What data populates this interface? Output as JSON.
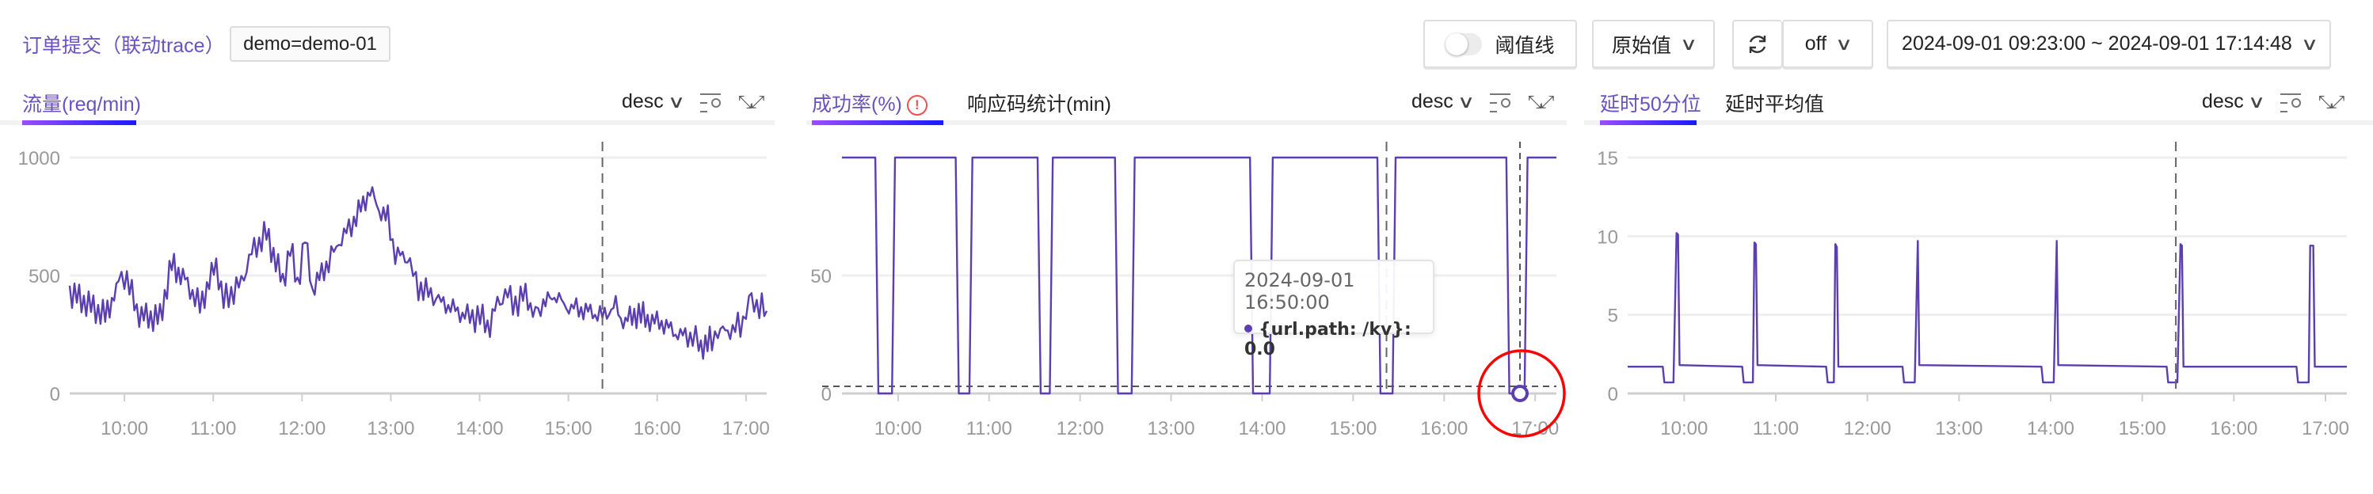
{
  "header": {
    "title": "订单提交（联动trace）",
    "tag": "demo=demo-01",
    "threshold_toggle": {
      "label": "阈值线",
      "on": false
    },
    "value_mode": {
      "label": "原始值",
      "icon": "chevron-down-icon"
    },
    "refresh": {
      "icon": "refresh-icon",
      "interval": "off"
    },
    "time_range": "2024-09-01 09:23:00 ~ 2024-09-01 17:14:48"
  },
  "colors": {
    "accent": "#6a52c0",
    "series": "#5b3fb0",
    "highlight": "#ff0000",
    "warn": "#f05050"
  },
  "panels": [
    {
      "tabs": [
        {
          "label": "流量(req/min)",
          "active": true
        }
      ],
      "sort": "desc",
      "warn_icon": false
    },
    {
      "tabs": [
        {
          "label": "成功率(%)",
          "active": true
        },
        {
          "label": "响应码统计(min)",
          "active": false
        }
      ],
      "sort": "desc",
      "warn_icon": "!"
    },
    {
      "tabs": [
        {
          "label": "延时50分位",
          "active": true
        },
        {
          "label": "延时平均值",
          "active": false
        }
      ],
      "sort": "desc",
      "warn_icon": false
    }
  ],
  "tooltip": {
    "time": "2024-09-01 16:50:00",
    "series": "{url.path: /kv}",
    "value": "0.0"
  },
  "chart_data": [
    {
      "type": "line",
      "xlim": [
        "09:23",
        "17:14"
      ],
      "xticks": [
        "10:00",
        "11:00",
        "12:00",
        "13:00",
        "14:00",
        "15:00",
        "16:00",
        "17:00"
      ],
      "ylim": [
        0,
        1000
      ],
      "yticks": [
        0,
        500,
        1000
      ],
      "grid": true,
      "marker_line": "15:23",
      "points": [
        [
          "09:23",
          430
        ],
        [
          "09:47",
          330
        ],
        [
          "09:56",
          460
        ],
        [
          "10:00",
          510
        ],
        [
          "10:10",
          330
        ],
        [
          "10:24",
          320
        ],
        [
          "10:32",
          550
        ],
        [
          "10:41",
          480
        ],
        [
          "10:51",
          370
        ],
        [
          "11:02",
          550
        ],
        [
          "11:07",
          390
        ],
        [
          "11:19",
          470
        ],
        [
          "11:26",
          600
        ],
        [
          "11:36",
          680
        ],
        [
          "11:47",
          470
        ],
        [
          "11:52",
          620
        ],
        [
          "11:57",
          460
        ],
        [
          "12:02",
          660
        ],
        [
          "12:07",
          440
        ],
        [
          "12:18",
          560
        ],
        [
          "12:25",
          640
        ],
        [
          "12:35",
          730
        ],
        [
          "12:46",
          860
        ],
        [
          "12:52",
          780
        ],
        [
          "12:58",
          740
        ],
        [
          "13:03",
          590
        ],
        [
          "13:13",
          570
        ],
        [
          "13:17",
          460
        ],
        [
          "13:27",
          420
        ],
        [
          "13:34",
          390
        ],
        [
          "13:50",
          330
        ],
        [
          "14:02",
          320
        ],
        [
          "14:07",
          280
        ],
        [
          "14:12",
          390
        ],
        [
          "14:19",
          420
        ],
        [
          "14:26",
          370
        ],
        [
          "14:31",
          440
        ],
        [
          "14:36",
          330
        ],
        [
          "14:43",
          380
        ],
        [
          "14:52",
          420
        ],
        [
          "14:57",
          370
        ],
        [
          "15:07",
          360
        ],
        [
          "15:18",
          340
        ],
        [
          "15:23",
          330
        ],
        [
          "15:32",
          370
        ],
        [
          "15:37",
          300
        ],
        [
          "15:46",
          340
        ],
        [
          "15:55",
          310
        ],
        [
          "16:03",
          300
        ],
        [
          "16:14",
          250
        ],
        [
          "16:24",
          240
        ],
        [
          "16:28",
          200
        ],
        [
          "16:37",
          220
        ],
        [
          "16:41",
          260
        ],
        [
          "16:51",
          270
        ],
        [
          "16:58",
          300
        ],
        [
          "17:02",
          400
        ],
        [
          "17:09",
          370
        ],
        [
          "17:14",
          350
        ]
      ]
    },
    {
      "type": "line",
      "xlim": [
        "09:23",
        "17:14"
      ],
      "xticks": [
        "10:00",
        "11:00",
        "12:00",
        "13:00",
        "14:00",
        "15:00",
        "16:00",
        "17:00"
      ],
      "ylim": [
        0,
        100
      ],
      "yticks": [
        0,
        50
      ],
      "grid": true,
      "marker_line": "15:22",
      "hover_line": "16:50",
      "threshold": 3,
      "highlight_point": [
        "16:50",
        0
      ],
      "points": [
        [
          "09:23",
          100
        ],
        [
          "09:45",
          100
        ],
        [
          "09:47",
          0
        ],
        [
          "09:56",
          0
        ],
        [
          "09:58",
          100
        ],
        [
          "10:38",
          100
        ],
        [
          "10:40",
          0
        ],
        [
          "10:47",
          0
        ],
        [
          "10:49",
          100
        ],
        [
          "11:32",
          100
        ],
        [
          "11:34",
          0
        ],
        [
          "11:40",
          0
        ],
        [
          "11:42",
          100
        ],
        [
          "12:23",
          100
        ],
        [
          "12:25",
          0
        ],
        [
          "12:34",
          0
        ],
        [
          "12:36",
          100
        ],
        [
          "13:52",
          100
        ],
        [
          "13:54",
          0
        ],
        [
          "14:05",
          0
        ],
        [
          "14:07",
          100
        ],
        [
          "15:16",
          100
        ],
        [
          "15:18",
          0
        ],
        [
          "15:26",
          0
        ],
        [
          "15:28",
          100
        ],
        [
          "16:41",
          100
        ],
        [
          "16:43",
          0
        ],
        [
          "16:53",
          0
        ],
        [
          "16:55",
          100
        ],
        [
          "17:14",
          100
        ]
      ]
    },
    {
      "type": "line",
      "xlim": [
        "09:23",
        "17:14"
      ],
      "xticks": [
        "10:00",
        "11:00",
        "12:00",
        "13:00",
        "14:00",
        "15:00",
        "16:00",
        "17:00"
      ],
      "ylim": [
        0,
        15
      ],
      "yticks": [
        0,
        5,
        10,
        15
      ],
      "grid": true,
      "marker_line": "15:22",
      "points": [
        [
          "09:23",
          1.7
        ],
        [
          "09:46",
          1.7
        ],
        [
          "09:47",
          0.7
        ],
        [
          "09:53",
          0.7
        ],
        [
          "09:55",
          10.2
        ],
        [
          "09:56",
          10.1
        ],
        [
          "09:57",
          1.8
        ],
        [
          "10:38",
          1.7
        ],
        [
          "10:39",
          0.7
        ],
        [
          "10:45",
          0.7
        ],
        [
          "10:46",
          9.6
        ],
        [
          "10:47",
          9.5
        ],
        [
          "10:48",
          1.8
        ],
        [
          "11:33",
          1.7
        ],
        [
          "11:34",
          0.7
        ],
        [
          "11:38",
          0.7
        ],
        [
          "11:39",
          9.5
        ],
        [
          "11:40",
          9.3
        ],
        [
          "11:41",
          1.7
        ],
        [
          "12:23",
          1.7
        ],
        [
          "12:24",
          0.7
        ],
        [
          "12:31",
          0.7
        ],
        [
          "12:33",
          9.7
        ],
        [
          "12:34",
          1.8
        ],
        [
          "13:54",
          1.7
        ],
        [
          "13:55",
          0.7
        ],
        [
          "14:02",
          0.7
        ],
        [
          "14:04",
          9.7
        ],
        [
          "14:05",
          1.8
        ],
        [
          "15:16",
          1.7
        ],
        [
          "15:17",
          0.7
        ],
        [
          "15:23",
          0.7
        ],
        [
          "15:25",
          9.5
        ],
        [
          "15:26",
          9.4
        ],
        [
          "15:27",
          1.7
        ],
        [
          "16:41",
          1.7
        ],
        [
          "16:42",
          0.7
        ],
        [
          "16:49",
          0.7
        ],
        [
          "16:50",
          9.4
        ],
        [
          "16:52",
          9.4
        ],
        [
          "16:53",
          1.7
        ],
        [
          "17:14",
          1.7
        ]
      ]
    }
  ]
}
